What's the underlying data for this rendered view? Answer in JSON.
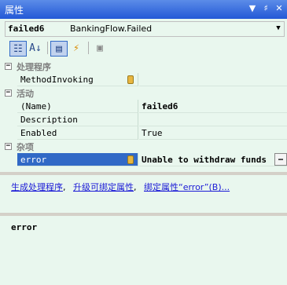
{
  "window": {
    "title": "属性",
    "buttons": [
      "▼",
      "♯",
      "✕"
    ]
  },
  "selector": {
    "object_name": "failed6",
    "object_type": "BankingFlow.Failed"
  },
  "toolbar": {
    "icons": [
      "categorized-icon",
      "alphabetical-icon",
      "properties-icon",
      "events-icon",
      "property-pages-icon"
    ]
  },
  "grid": {
    "categories": [
      {
        "label": "处理程序",
        "properties": [
          {
            "name": "MethodInvoking",
            "value": "",
            "bound": true
          }
        ]
      },
      {
        "label": "活动",
        "properties": [
          {
            "name": "(Name)",
            "value": "failed6",
            "bold": true
          },
          {
            "name": "Description",
            "value": ""
          },
          {
            "name": "Enabled",
            "value": "True"
          }
        ]
      },
      {
        "label": "杂项",
        "properties": [
          {
            "name": "error",
            "value": "Unable to withdraw funds",
            "bold": true,
            "selected": true,
            "bound": true
          }
        ]
      }
    ]
  },
  "commands": {
    "link1": "生成处理程序",
    "link2": "升级可绑定属性",
    "link3": "绑定属性“error”(B)...",
    "separator": ","
  },
  "description": {
    "name": "error"
  }
}
